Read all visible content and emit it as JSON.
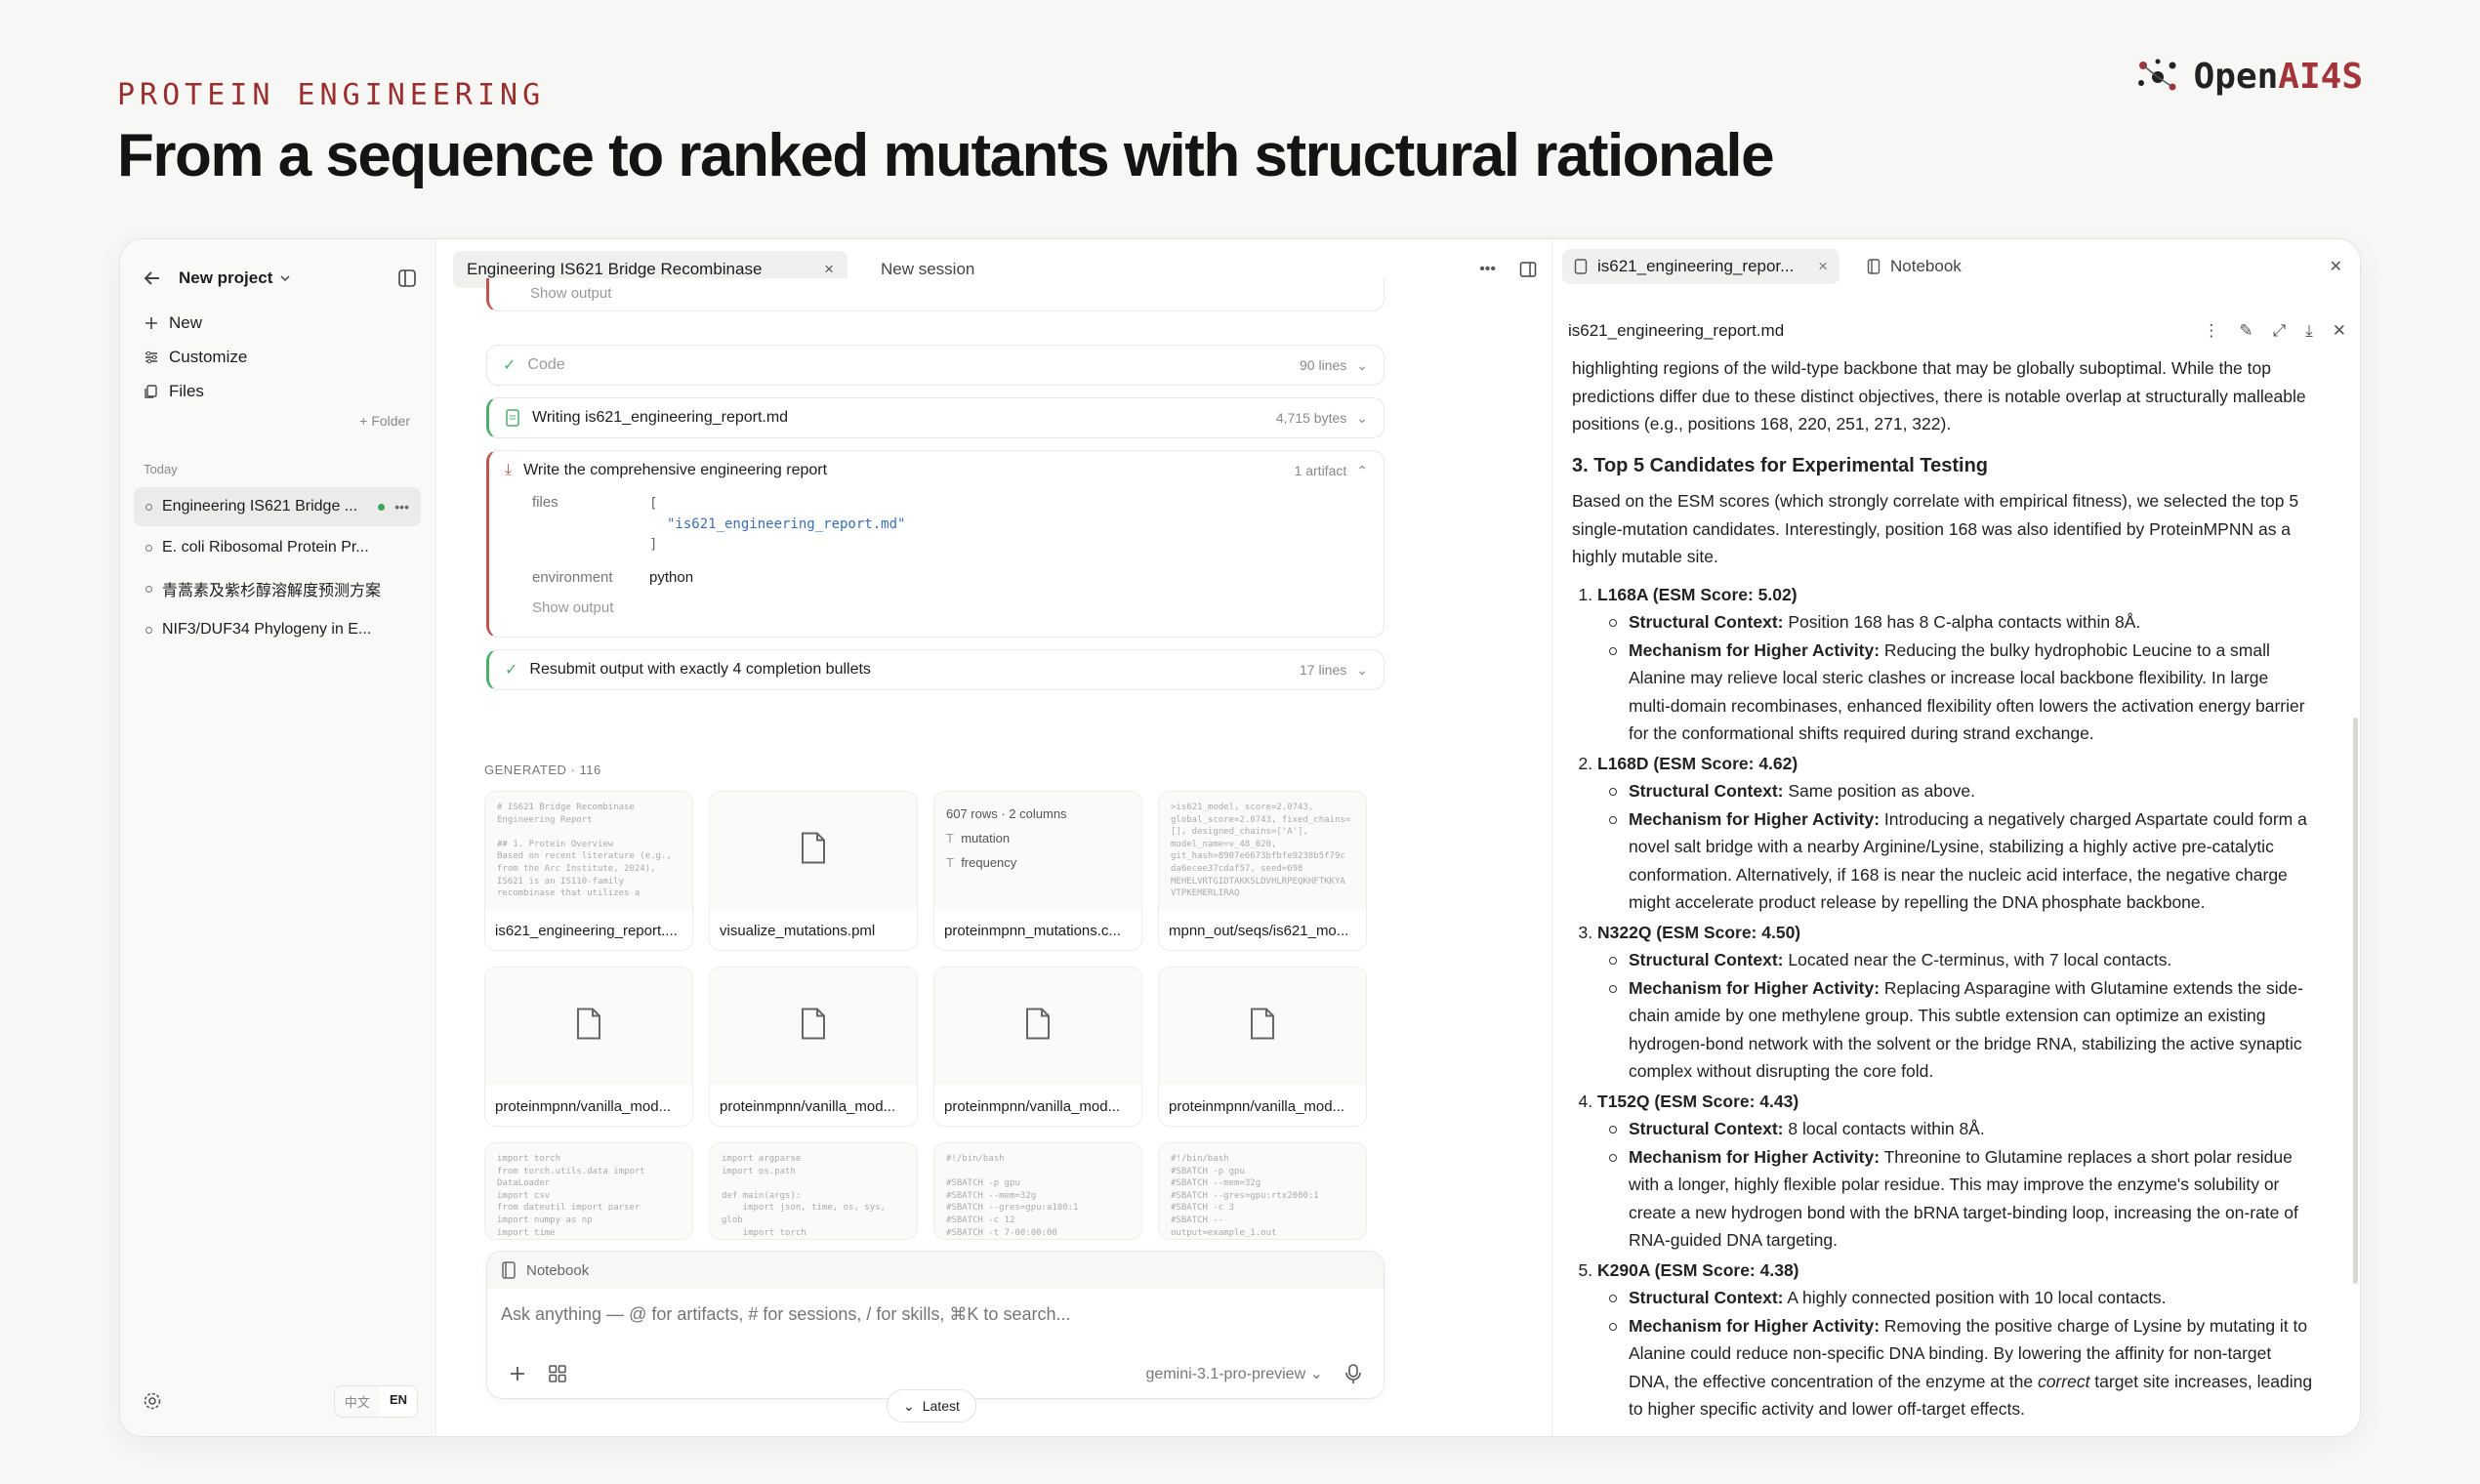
{
  "page": {
    "kicker": "PROTEIN ENGINEERING",
    "headline": "From a sequence to ranked mutants with structural rationale",
    "brand_open": "Open",
    "brand_ai": "AI4S"
  },
  "sidebar": {
    "project_title": "New project",
    "menu": [
      {
        "label": "New",
        "icon": "plus-icon"
      },
      {
        "label": "Customize",
        "icon": "sliders-icon"
      },
      {
        "label": "Files",
        "icon": "files-icon"
      }
    ],
    "folder_label": "+ Folder",
    "today_label": "Today",
    "sessions": [
      {
        "label": "Engineering IS621 Bridge ...",
        "active": true
      },
      {
        "label": "E. coli Ribosomal Protein Pr..."
      },
      {
        "label": "青蒿素及紫杉醇溶解度预测方案"
      },
      {
        "label": "NIF3/DUF34 Phylogeny in E..."
      }
    ],
    "lang_zh": "中文",
    "lang_en": "EN"
  },
  "center": {
    "tab_active": "Engineering IS621 Bridge Recombinase",
    "tab_new": "New session",
    "steps": {
      "show_output_top": "Show output",
      "code_label": "Code",
      "code_meta": "90 lines",
      "writing_label": "Writing is621_engineering_report.md",
      "writing_meta": "4,715 bytes",
      "report_label": "Write the comprehensive engineering report",
      "report_meta": "1 artifact",
      "files_key": "files",
      "files_open": "[",
      "files_value": "\"is621_engineering_report.md\"",
      "files_close": "]",
      "env_key": "environment",
      "env_value": "python",
      "show_output": "Show output",
      "resubmit_label": "Resubmit output with exactly 4 completion bullets",
      "resubmit_meta": "17 lines"
    },
    "generated_label": "GENERATED · 116",
    "tiles": [
      {
        "name": "is621_engineering_report....",
        "preview": "# IS621 Bridge Recombinase\nEngineering Report\n\n## 1. Protein Overview\nBased on recent literature (e.g.,\nfrom the Arc Institute, 2024),\nIS621 is an IS110-family\nrecombinase that utilizes a"
      },
      {
        "name": "visualize_mutations.pml",
        "icon": "file-icon"
      },
      {
        "name": "proteinmpnn_mutations.c...",
        "csv_rows": "607 rows · 2 columns",
        "csv_cols": [
          "mutation",
          "frequency"
        ]
      },
      {
        "name": "mpnn_out/seqs/is621_mo...",
        "preview": ">is621_model, score=2.0743,\nglobal_score=2.0743, fixed_chains=\n[], designed_chains=['A'],\nmodel_name=v_48_020,\ngit_hash=8907e6673bfbfe9238b5f79c\nda6ecee37cdaf57, seed=698\nMEHELVRTGIDTAKKSLDVHLRPEQKHFTKKYA\nVTPKEMERLIRAQ"
      },
      {
        "name": "proteinmpnn/vanilla_mod...",
        "icon": "file-icon"
      },
      {
        "name": "proteinmpnn/vanilla_mod...",
        "icon": "file-icon"
      },
      {
        "name": "proteinmpnn/vanilla_mod...",
        "icon": "file-icon"
      },
      {
        "name": "proteinmpnn/vanilla_mod...",
        "icon": "file-icon"
      },
      {
        "preview": "import torch\nfrom torch.utils.data import\nDataLoader\nimport csv\nfrom dateutil import parser\nimport numpy as np\nimport time"
      },
      {
        "preview": "import argparse\nimport os.path\n\ndef main(args):\n    import json, time, os, sys,\nglob\n    import torch"
      },
      {
        "preview": "#!/bin/bash\n\n#SBATCH -p gpu\n#SBATCH --mem=32g\n#SBATCH --gres=gpu:a100:1\n#SBATCH -c 12\n#SBATCH -t 7-00:00:00"
      },
      {
        "preview": "#!/bin/bash\n#SBATCH -p gpu\n#SBATCH --mem=32g\n#SBATCH --gres=gpu:rtx2080:1\n#SBATCH -c 3\n#SBATCH --\noutput=example_1.out"
      }
    ],
    "composer": {
      "notebook_label": "Notebook",
      "placeholder": "Ask anything — @ for artifacts, # for sessions, / for skills, ⌘K to search...",
      "model": "gemini-3.1-pro-preview"
    },
    "latest_label": "Latest"
  },
  "right": {
    "tab_active": "is621_engineering_repor...",
    "tab_notebook": "Notebook",
    "file_title": "is621_engineering_report.md",
    "doc": {
      "intro": "highlighting regions of the wild-type backbone that may be globally suboptimal. While the top predictions differ due to these distinct objectives, there is notable overlap at structurally malleable positions (e.g., positions 168, 220, 251, 271, 322).",
      "h3": "3. Top 5 Candidates for Experimental Testing",
      "p2": "Based on the ESM scores (which strongly correlate with empirical fitness), we selected the top 5 single-mutation candidates. Interestingly, position 168 was also identified by ProteinMPNN as a highly mutable site.",
      "sc_label": "Structural Context:",
      "mech_label": "Mechanism for Higher Activity:",
      "candidates": [
        {
          "title": "L168A (ESM Score: 5.02)",
          "context": "Position 168 has 8 C-alpha contacts within 8Å.",
          "mechanism": "Reducing the bulky hydrophobic Leucine to a small Alanine may relieve local steric clashes or increase local backbone flexibility. In large multi-domain recombinases, enhanced flexibility often lowers the activation energy barrier for the conformational shifts required during strand exchange."
        },
        {
          "title": "L168D (ESM Score: 4.62)",
          "context": "Same position as above.",
          "mechanism": "Introducing a negatively charged Aspartate could form a novel salt bridge with a nearby Arginine/Lysine, stabilizing a highly active pre-catalytic conformation. Alternatively, if 168 is near the nucleic acid interface, the negative charge might accelerate product release by repelling the DNA phosphate backbone."
        },
        {
          "title": "N322Q (ESM Score: 4.50)",
          "context": "Located near the C-terminus, with 7 local contacts.",
          "mechanism": "Replacing Asparagine with Glutamine extends the side-chain amide by one methylene group. This subtle extension can optimize an existing hydrogen-bond network with the solvent or the bridge RNA, stabilizing the active synaptic complex without disrupting the core fold."
        },
        {
          "title": "T152Q (ESM Score: 4.43)",
          "context": "8 local contacts within 8Å.",
          "mechanism": "Threonine to Glutamine replaces a short polar residue with a longer, highly flexible polar residue. This may improve the enzyme's solubility or create a new hydrogen bond with the bRNA target-binding loop, increasing the on-rate of RNA-guided DNA targeting."
        },
        {
          "title": "K290A (ESM Score: 4.38)",
          "context": "A highly connected position with 10 local contacts.",
          "mechanism_pre": "Removing the positive charge of Lysine by mutating it to Alanine could reduce non-specific DNA binding. By lowering the affinity for non-target DNA, the effective concentration of the enzyme at the ",
          "mechanism_em": "correct",
          "mechanism_post": " target site increases, leading to higher specific activity and lower off-target effects."
        }
      ]
    }
  }
}
